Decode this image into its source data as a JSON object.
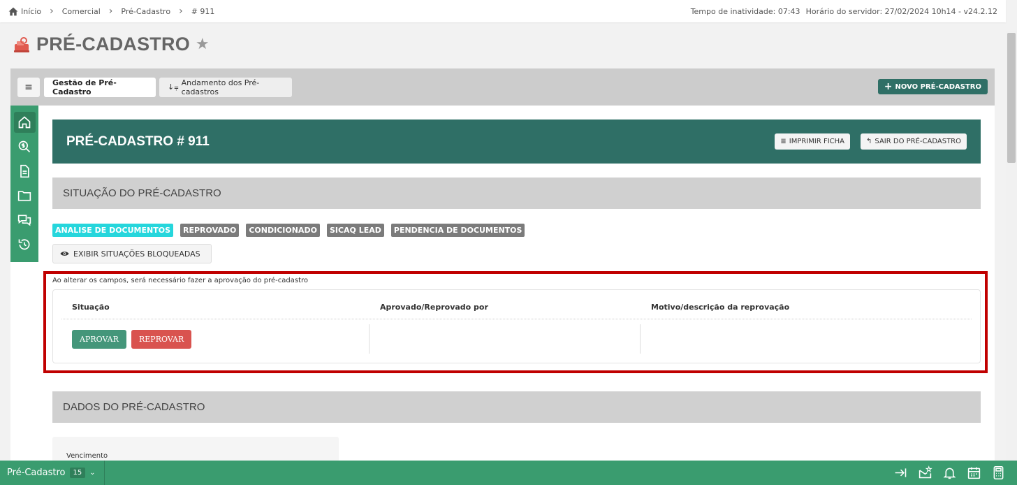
{
  "breadcrumb": [
    {
      "label": "Início"
    },
    {
      "label": "Comercial"
    },
    {
      "label": "Pré-Cadastro"
    },
    {
      "label": "# 911"
    }
  ],
  "topinfo": {
    "inactivity": "Tempo de inatividade: 07:43",
    "server_time": "Horário do servidor: 27/02/2024 10h14 - v24.2.12"
  },
  "page": {
    "title": "PRÉ-CADASTRO",
    "icon": "register-machine-icon"
  },
  "tabs": [
    {
      "label": "Gestão de Pré-Cadastro",
      "active": true
    },
    {
      "label": "Andamento dos Pré-cadastros",
      "active": false
    }
  ],
  "toolbar": {
    "new_label": "NOVO PRÉ-CADASTRO"
  },
  "sidebar": {
    "items": [
      {
        "icon": "home-icon"
      },
      {
        "icon": "search-dollar-icon"
      },
      {
        "icon": "document-icon"
      },
      {
        "icon": "folder-icon"
      },
      {
        "icon": "chat-icon"
      },
      {
        "icon": "history-icon"
      }
    ]
  },
  "header": {
    "title": "PRÉ-CADASTRO # 911",
    "print_label": "IMPRIMIR FICHA",
    "exit_label": "SAIR DO PRÉ-CADASTRO"
  },
  "status_section": {
    "title": "SITUAÇÃO DO PRÉ-CADASTRO",
    "badges": [
      {
        "label": "ANALISE DE DOCUMENTOS",
        "current": true
      },
      {
        "label": "REPROVADO",
        "current": false
      },
      {
        "label": "CONDICIONADO",
        "current": false
      },
      {
        "label": "SICAQ LEAD",
        "current": false
      },
      {
        "label": "PENDENCIA DE DOCUMENTOS",
        "current": false
      }
    ],
    "show_blocked_label": "EXIBIR SITUAÇÕES BLOQUEADAS",
    "current_color": "#26d6dc"
  },
  "approval": {
    "note": "Ao alterar os campos, será necessário fazer a aprovação do pré-cadastro",
    "columns": [
      "Situação",
      "Aprovado/Reprovado por",
      "Motivo/descrição da reprovação"
    ],
    "approve_label": "APROVAR",
    "reject_label": "REPROVAR",
    "highlight_color": "#c00000"
  },
  "data_section": {
    "title": "DADOS DO PRÉ-CADASTRO",
    "first_field_label": "Vencimento"
  },
  "bottombar": {
    "module_label": "Pré-Cadastro",
    "count": "15",
    "icons": [
      "collapse-right-icon",
      "mail-star-icon",
      "bell-icon",
      "calendar-icon",
      "calculator-icon"
    ]
  },
  "colors": {
    "brand_dark": "#2f6f66",
    "brand_green": "#3a9c6f"
  }
}
